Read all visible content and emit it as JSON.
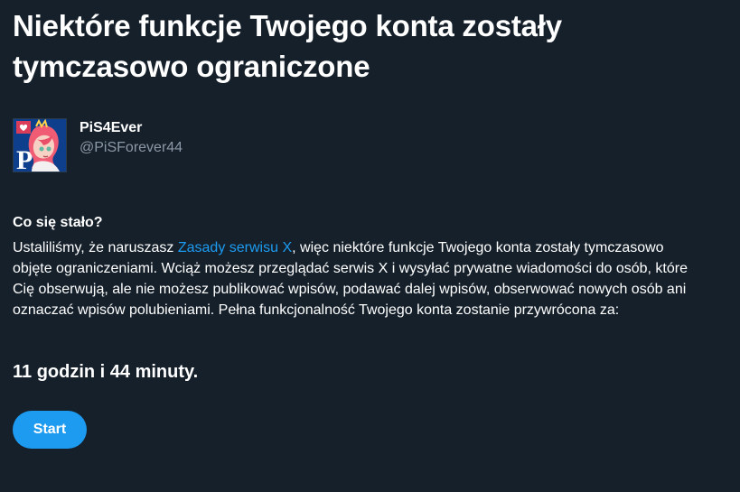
{
  "title": "Niektóre funkcje Twojego konta zostały tymczasowo ograniczone",
  "account": {
    "display_name": "PiS4Ever",
    "handle": "@PiSForever44",
    "avatar_icon": "anime-avatar-icon"
  },
  "section_title": "Co się stało?",
  "message": {
    "before_link": "Ustaliliśmy, że naruszasz ",
    "link_text": "Zasady serwisu X",
    "after_link": ", więc niektóre funkcje Twojego konta zostały tymczasowo objęte ograniczeniami. Wciąż możesz przeglądać serwis X i wysyłać prywatne wiadomości do osób, które Cię obserwują, ale nie możesz publikować wpisów, podawać dalej wpisów, obserwować nowych osób ani oznaczać wpisów polubieniami. Pełna funkcjonalność Twojego konta zostanie przywrócona za:"
  },
  "countdown": "11 godzin i 44 minuty.",
  "start_button": "Start",
  "colors": {
    "background": "#15202b",
    "text": "#ffffff",
    "muted": "#8b98a5",
    "accent": "#1d9bf0"
  }
}
